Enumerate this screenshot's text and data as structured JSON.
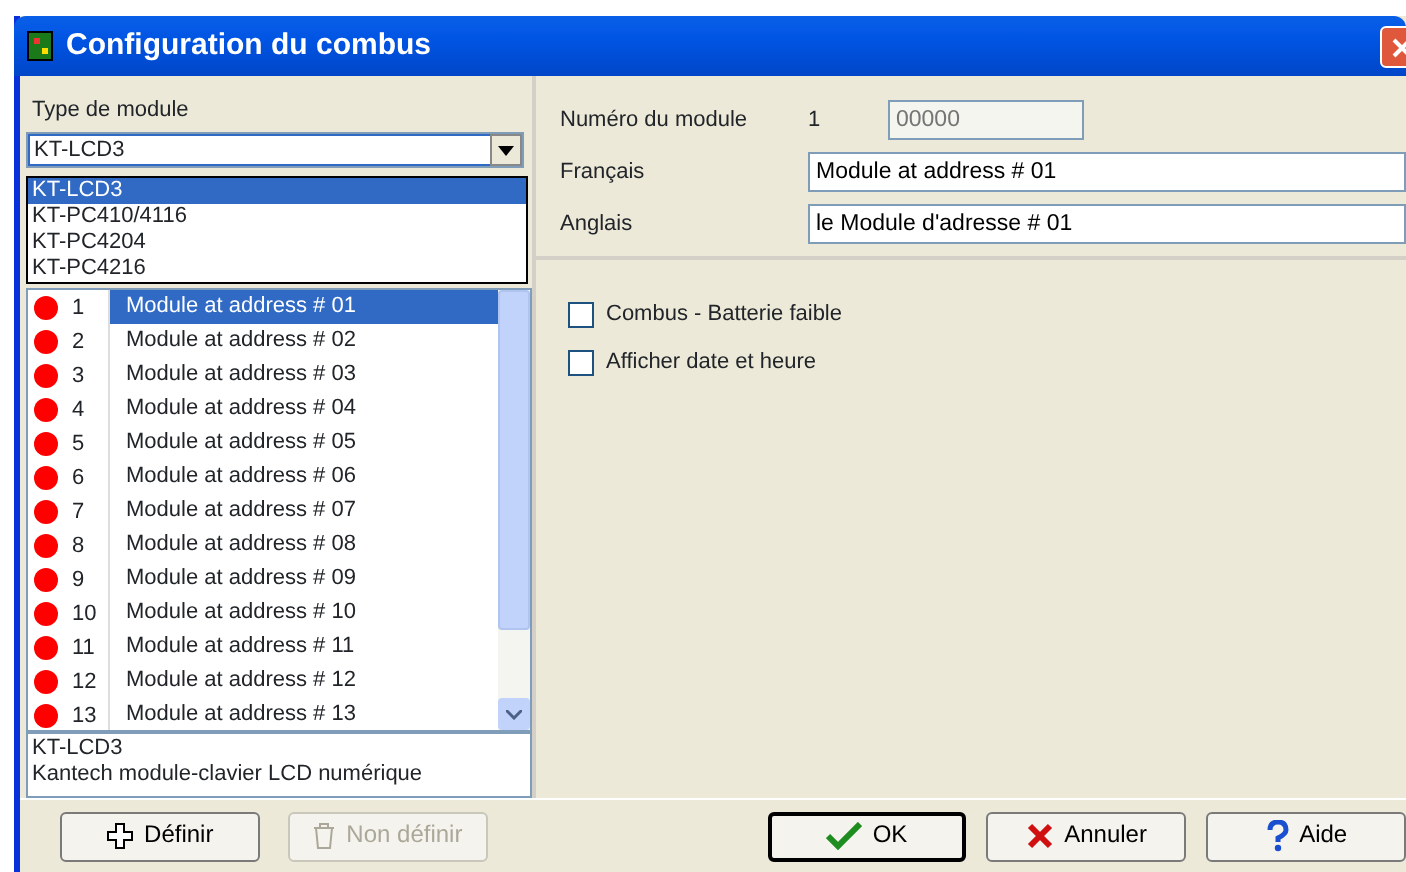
{
  "window": {
    "title": "Configuration du combus"
  },
  "module_type": {
    "label": "Type de module",
    "value": "KT-LCD3",
    "expanded": true,
    "options": [
      {
        "label": "KT-LCD3",
        "selected": true
      },
      {
        "label": "KT-PC410/4116",
        "selected": false
      },
      {
        "label": "KT-PC4204",
        "selected": false
      },
      {
        "label": "KT-PC4216",
        "selected": false
      }
    ]
  },
  "modules": [
    {
      "number": "1",
      "name": "Module at address # 01",
      "color": "#ff0000",
      "selected": true
    },
    {
      "number": "2",
      "name": "Module at address # 02",
      "color": "#ff0000",
      "selected": false
    },
    {
      "number": "3",
      "name": "Module at address # 03",
      "color": "#ff0000",
      "selected": false
    },
    {
      "number": "4",
      "name": "Module at address # 04",
      "color": "#ff0000",
      "selected": false
    },
    {
      "number": "5",
      "name": "Module at address # 05",
      "color": "#ff0000",
      "selected": false
    },
    {
      "number": "6",
      "name": "Module at address # 06",
      "color": "#ff0000",
      "selected": false
    },
    {
      "number": "7",
      "name": "Module at address # 07",
      "color": "#ff0000",
      "selected": false
    },
    {
      "number": "8",
      "name": "Module at address # 08",
      "color": "#ff0000",
      "selected": false
    },
    {
      "number": "9",
      "name": "Module at address # 09",
      "color": "#ff0000",
      "selected": false
    },
    {
      "number": "10",
      "name": "Module at address # 10",
      "color": "#ff0000",
      "selected": false
    },
    {
      "number": "11",
      "name": "Module at address # 11",
      "color": "#ff0000",
      "selected": false
    },
    {
      "number": "12",
      "name": "Module at address # 12",
      "color": "#ff0000",
      "selected": false
    },
    {
      "number": "13",
      "name": "Module at address # 13",
      "color": "#ff0000",
      "selected": false
    }
  ],
  "description": [
    "KT-LCD3",
    "Kantech module-clavier LCD numérique"
  ],
  "details": {
    "number_label": "Numéro du module",
    "number": "1",
    "code_placeholder": "00000",
    "french_label": "Français",
    "french_value": "Module at address # 01",
    "english_label": "Anglais",
    "english_value": "le Module d'adresse # 01"
  },
  "options": [
    {
      "label": "Combus - Batterie faible",
      "checked": false
    },
    {
      "label": "Afficher date et heure",
      "checked": false
    }
  ],
  "buttons": [
    {
      "kind": "define",
      "label": "Définir",
      "disabled": false
    },
    {
      "kind": "undefine",
      "label": "Non définir",
      "disabled": true
    },
    {
      "kind": "ok",
      "label": "OK",
      "disabled": false
    },
    {
      "kind": "cancel",
      "label": "Annuler",
      "disabled": false
    },
    {
      "kind": "help",
      "label": "Aide",
      "disabled": false
    }
  ]
}
